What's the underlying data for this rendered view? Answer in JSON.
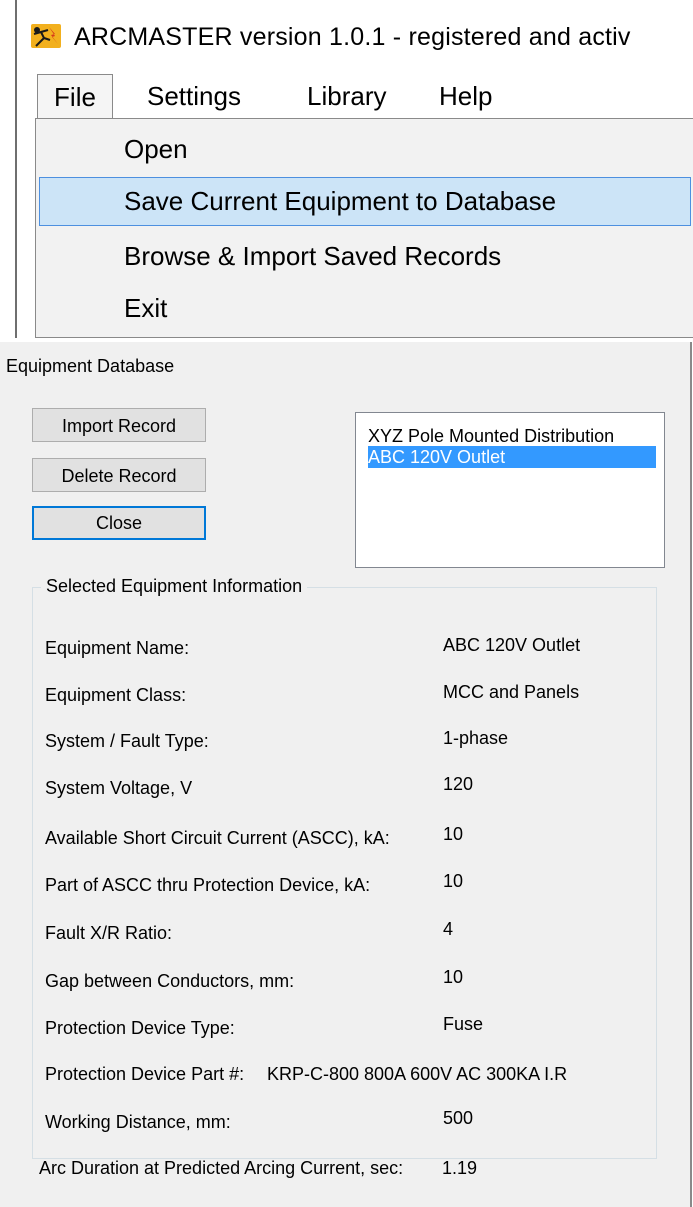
{
  "top_window": {
    "title": "ARCMASTER version 1.0.1 - registered and activ",
    "menu": [
      "File",
      "Settings",
      "Library",
      "Help"
    ],
    "dropdown": [
      "Open",
      "Save Current Equipment to Database",
      "Browse & Import Saved Records",
      "Exit"
    ],
    "highlighted_item": "Save Current Equipment to Database"
  },
  "db_window": {
    "title": "Equipment Database",
    "buttons": {
      "import": "Import Record",
      "delete": "Delete Record",
      "close": "Close"
    },
    "records": [
      "XYZ Pole Mounted Distribution",
      "ABC 120V Outlet"
    ],
    "selected_record": "ABC 120V Outlet",
    "info": {
      "legend": "Selected Equipment Information",
      "rows": [
        {
          "label": "Equipment Name:",
          "value": "ABC 120V Outlet"
        },
        {
          "label": "Equipment Class:",
          "value": "MCC and Panels"
        },
        {
          "label": "System / Fault Type:",
          "value": "1-phase"
        },
        {
          "label": "System Voltage, V",
          "value": "120"
        },
        {
          "label": "Available Short Circuit Current (ASCC), kA:",
          "value": "10"
        },
        {
          "label": "Part of ASCC thru Protection Device, kA:",
          "value": "10"
        },
        {
          "label": "Fault X/R Ratio:",
          "value": "4"
        },
        {
          "label": "Gap between Conductors, mm:",
          "value": "10"
        },
        {
          "label": "Protection Device Type:",
          "value": "Fuse"
        },
        {
          "label": "Protection Device Part #:",
          "value": "KRP-C-800 800A 600V AC 300KA I.R"
        },
        {
          "label": "Working Distance, mm:",
          "value": "500"
        },
        {
          "label": "Arc Duration at Predicted Arcing Current, sec:",
          "value": "1.19"
        }
      ]
    }
  },
  "colors": {
    "menu_highlight": "#cce4f7",
    "list_selection": "#3399ff",
    "icon": "#f2b01e"
  }
}
